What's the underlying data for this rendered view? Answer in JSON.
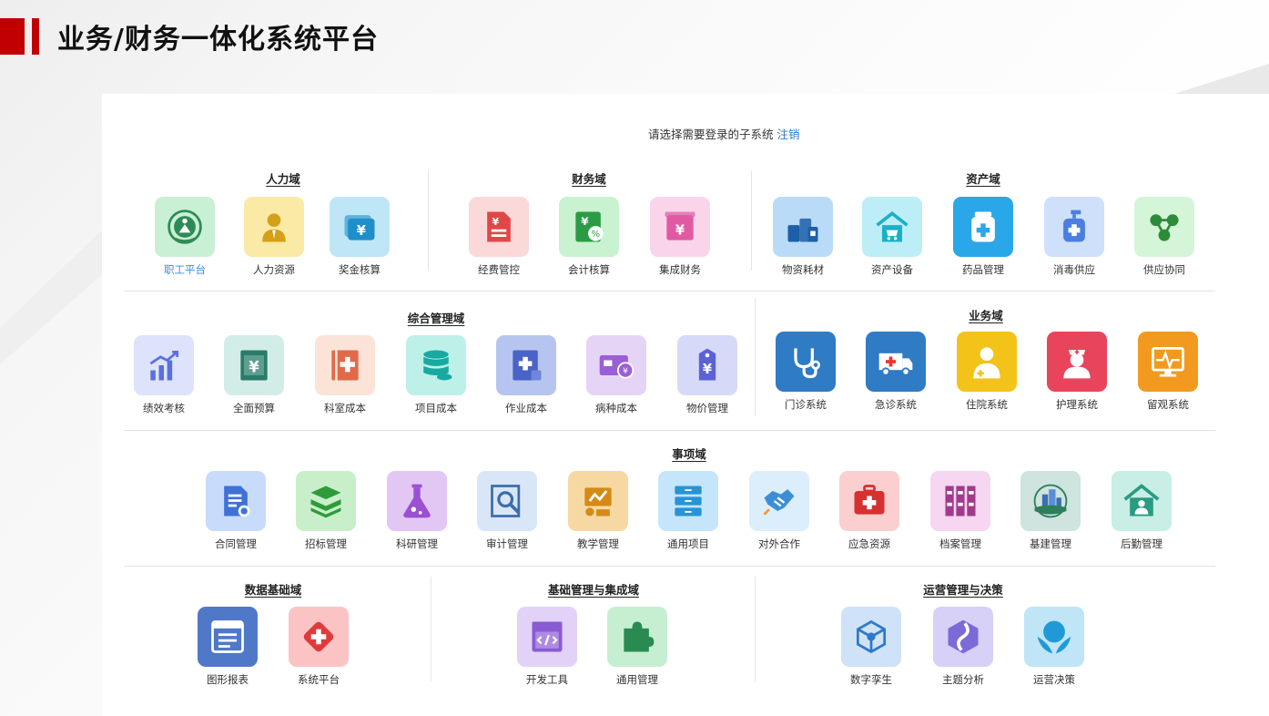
{
  "header": {
    "title": "业务/财务一体化系统平台"
  },
  "prompt": {
    "text": "请选择需要登录的子系统",
    "logout": "注销"
  },
  "domains": {
    "hr": {
      "title": "人力域",
      "apps": [
        {
          "label": "职工平台",
          "icon": "emblem-icon",
          "bg": "#c9f0d4",
          "fg": "#2e8b57"
        },
        {
          "label": "人力资源",
          "icon": "person-icon",
          "bg": "#fbe9a6",
          "fg": "#d4a017"
        },
        {
          "label": "奖金核算",
          "icon": "wallet-icon",
          "bg": "#bfe6f7",
          "fg": "#1f8fc9"
        }
      ]
    },
    "finance": {
      "title": "财务域",
      "apps": [
        {
          "label": "经费管控",
          "icon": "yuan-document-icon",
          "bg": "#fbd9d9",
          "fg": "#e04848"
        },
        {
          "label": "会计核算",
          "icon": "yuan-calculator-icon",
          "bg": "#c8f2d0",
          "fg": "#2b9b45"
        },
        {
          "label": "集成财务",
          "icon": "yuan-box-icon",
          "bg": "#fad5ea",
          "fg": "#e05aa3"
        }
      ]
    },
    "asset": {
      "title": "资产域",
      "apps": [
        {
          "label": "物资耗材",
          "icon": "bottles-icon",
          "bg": "#b9dbf7",
          "fg": "#1d5fa8"
        },
        {
          "label": "资产设备",
          "icon": "house-cart-icon",
          "bg": "#bdeef7",
          "fg": "#1ab0c8"
        },
        {
          "label": "药品管理",
          "icon": "medicine-jar-icon",
          "bg": "#2aa7e8",
          "fg": "#ffffff"
        },
        {
          "label": "消毒供应",
          "icon": "disinfect-bottle-icon",
          "bg": "#cfe0fb",
          "fg": "#4a7fe0"
        },
        {
          "label": "供应协同",
          "icon": "share-icon",
          "bg": "#d5f5d8",
          "fg": "#2e8b3a"
        }
      ]
    },
    "integrated": {
      "title": "综合管理域",
      "apps": [
        {
          "label": "绩效考核",
          "icon": "chart-growth-icon",
          "bg": "#dde3fb",
          "fg": "#5a6fe0"
        },
        {
          "label": "全面预算",
          "icon": "yuan-book-icon",
          "bg": "#d2ede7",
          "fg": "#2a7b6a"
        },
        {
          "label": "科室成本",
          "icon": "medical-book-icon",
          "bg": "#fbe3d8",
          "fg": "#e06a4a"
        },
        {
          "label": "项目成本",
          "icon": "database-icon",
          "bg": "#bdf0e8",
          "fg": "#18a9a0"
        },
        {
          "label": "作业成本",
          "icon": "notebook-plus-icon",
          "bg": "#b6c5ef",
          "fg": "#4a63c7"
        },
        {
          "label": "病种成本",
          "icon": "card-coin-icon",
          "bg": "#e6d4f7",
          "fg": "#9a5fd6"
        },
        {
          "label": "物价管理",
          "icon": "price-tag-icon",
          "bg": "#d7d9f8",
          "fg": "#5b62d6"
        }
      ]
    },
    "business": {
      "title": "业务域",
      "apps": [
        {
          "label": "门诊系统",
          "icon": "stethoscope-icon",
          "bg": "#2f7bc4",
          "fg": "#ffffff"
        },
        {
          "label": "急诊系统",
          "icon": "ambulance-icon",
          "bg": "#2f7bc4",
          "fg": "#ffffff"
        },
        {
          "label": "住院系统",
          "icon": "doctor-icon",
          "bg": "#f3c31a",
          "fg": "#ffffff"
        },
        {
          "label": "护理系统",
          "icon": "nurse-icon",
          "bg": "#e8455c",
          "fg": "#ffffff"
        },
        {
          "label": "留观系统",
          "icon": "monitor-icon",
          "bg": "#f29a1f",
          "fg": "#ffffff"
        }
      ]
    },
    "affairs": {
      "title": "事项域",
      "apps": [
        {
          "label": "合同管理",
          "icon": "contract-icon",
          "bg": "#c9dbfa",
          "fg": "#3f72d6"
        },
        {
          "label": "招标管理",
          "icon": "stack-icon",
          "bg": "#c8efc9",
          "fg": "#2e9b3a"
        },
        {
          "label": "科研管理",
          "icon": "flask-icon",
          "bg": "#e2c7f5",
          "fg": "#9b4fd2"
        },
        {
          "label": "审计管理",
          "icon": "magnifier-doc-icon",
          "bg": "#d8e6f7",
          "fg": "#3d6ea8"
        },
        {
          "label": "教学管理",
          "icon": "teaching-icon",
          "bg": "#f6d8a2",
          "fg": "#d48a14"
        },
        {
          "label": "通用项目",
          "icon": "cabinet-icon",
          "bg": "#c4e5fa",
          "fg": "#2893d6"
        },
        {
          "label": "对外合作",
          "icon": "handshake-icon",
          "bg": "#dcedfb",
          "fg": "#3c8fd6"
        },
        {
          "label": "应急资源",
          "icon": "first-aid-icon",
          "bg": "#fbcfcf",
          "fg": "#d63030"
        },
        {
          "label": "档案管理",
          "icon": "archive-icon",
          "bg": "#f6d6f0",
          "fg": "#a03a8c"
        },
        {
          "label": "基建管理",
          "icon": "buildings-icon",
          "bg": "#cfe3df",
          "fg": "#2c7f5a"
        },
        {
          "label": "后勤管理",
          "icon": "home-person-icon",
          "bg": "#c8eee6",
          "fg": "#2a9b80"
        }
      ]
    },
    "data": {
      "title": "数据基础域",
      "apps": [
        {
          "label": "图形报表",
          "icon": "report-window-icon",
          "bg": "#4f78c8",
          "fg": "#ffffff"
        },
        {
          "label": "系统平台",
          "icon": "diamond-cross-icon",
          "bg": "#fbc3c3",
          "fg": "#e03a3a"
        }
      ]
    },
    "foundation": {
      "title": "基础管理与集成域",
      "apps": [
        {
          "label": "开发工具",
          "icon": "code-window-icon",
          "bg": "#e2d2f7",
          "fg": "#8a5ad6"
        },
        {
          "label": "通用管理",
          "icon": "puzzle-icon",
          "bg": "#c6efd2",
          "fg": "#2a8b52"
        }
      ]
    },
    "operation": {
      "title": "运营管理与决策",
      "apps": [
        {
          "label": "数字孪生",
          "icon": "cube-icon",
          "bg": "#cfe2f7",
          "fg": "#2f79c8"
        },
        {
          "label": "主题分析",
          "icon": "road-hexagon-icon",
          "bg": "#d7d0f7",
          "fg": "#7b6ad8"
        },
        {
          "label": "运营决策",
          "icon": "leaf-globe-icon",
          "bg": "#bfe5f7",
          "fg": "#1f9ad6"
        }
      ]
    }
  }
}
